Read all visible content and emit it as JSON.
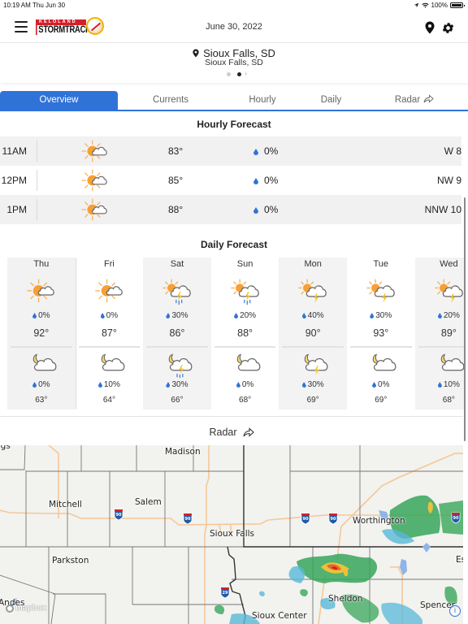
{
  "status_bar": {
    "time": "10:19 AM",
    "date": "Thu Jun 30",
    "battery": "100%",
    "battery_level": 1.0
  },
  "header": {
    "logo_top": "KELOLAND",
    "logo_main": "STORMTRACKER",
    "date": "June 30, 2022",
    "icons": [
      "menu-icon",
      "location-pin-icon",
      "gear-icon"
    ]
  },
  "location": {
    "title": "Sioux Falls, SD",
    "subtitle": "Sioux Falls, SD",
    "page_count": 2,
    "active_page": 2,
    "add_label": "+"
  },
  "tabs": [
    {
      "label": "Overview",
      "active": true
    },
    {
      "label": "Currents",
      "active": false
    },
    {
      "label": "Hourly",
      "active": false
    },
    {
      "label": "Daily",
      "active": false
    },
    {
      "label": "Radar",
      "active": false,
      "icon": "share-icon"
    }
  ],
  "hourly": {
    "title": "Hourly Forecast",
    "rows": [
      {
        "time": "11AM",
        "icon": "partly-sunny-icon",
        "temp": "83°",
        "precip": "0%",
        "wind": "W 8"
      },
      {
        "time": "12PM",
        "icon": "partly-sunny-icon",
        "temp": "85°",
        "precip": "0%",
        "wind": "NW 9"
      },
      {
        "time": "1PM",
        "icon": "partly-sunny-icon",
        "temp": "88°",
        "precip": "0%",
        "wind": "NNW 10"
      }
    ]
  },
  "daily": {
    "title": "Daily Forecast",
    "days": [
      {
        "name": "Thu",
        "day_icon": "partly-sunny",
        "day_precip": "0%",
        "high": "92°",
        "night_icon": "partly-cloudy-night",
        "night_precip": "0%",
        "low": "63°"
      },
      {
        "name": "Fri",
        "day_icon": "partly-sunny",
        "day_precip": "0%",
        "high": "87°",
        "night_icon": "partly-cloudy-night",
        "night_precip": "10%",
        "low": "64°"
      },
      {
        "name": "Sat",
        "day_icon": "sun-thunderstorm-rain",
        "day_precip": "30%",
        "high": "86°",
        "night_icon": "night-thunderstorm-rain",
        "night_precip": "30%",
        "low": "66°"
      },
      {
        "name": "Sun",
        "day_icon": "sun-thunderstorm-rain",
        "day_precip": "20%",
        "high": "88°",
        "night_icon": "partly-cloudy-night",
        "night_precip": "0%",
        "low": "68°"
      },
      {
        "name": "Mon",
        "day_icon": "sun-thunderstorm",
        "day_precip": "40%",
        "high": "90°",
        "night_icon": "night-thunderstorm",
        "night_precip": "30%",
        "low": "69°"
      },
      {
        "name": "Tue",
        "day_icon": "sun-thunderstorm",
        "day_precip": "30%",
        "high": "93°",
        "night_icon": "partly-cloudy-night",
        "night_precip": "0%",
        "low": "69°"
      },
      {
        "name": "Wed",
        "day_icon": "sun-thunderstorm",
        "day_precip": "20%",
        "high": "89°",
        "night_icon": "partly-cloudy-night",
        "night_precip": "10%",
        "low": "68°"
      }
    ]
  },
  "radar": {
    "title": "Radar",
    "map_labels": [
      "ngs",
      "Madison",
      "Mitchell",
      "Salem",
      "Sioux Falls",
      "Worthington",
      "Parkston",
      "Andes",
      "Sheldon",
      "Sioux Center",
      "Spencer",
      "Est"
    ],
    "highway_shields": [
      "90",
      "90",
      "90",
      "90",
      "90",
      "29"
    ],
    "attribution": "mapbox",
    "info_label": "i"
  },
  "colors": {
    "accent": "#2f73d9",
    "sun": "#f7a035",
    "bolt": "#f5c518",
    "rain": "#2f73d9",
    "logo_red": "#d4202a"
  }
}
